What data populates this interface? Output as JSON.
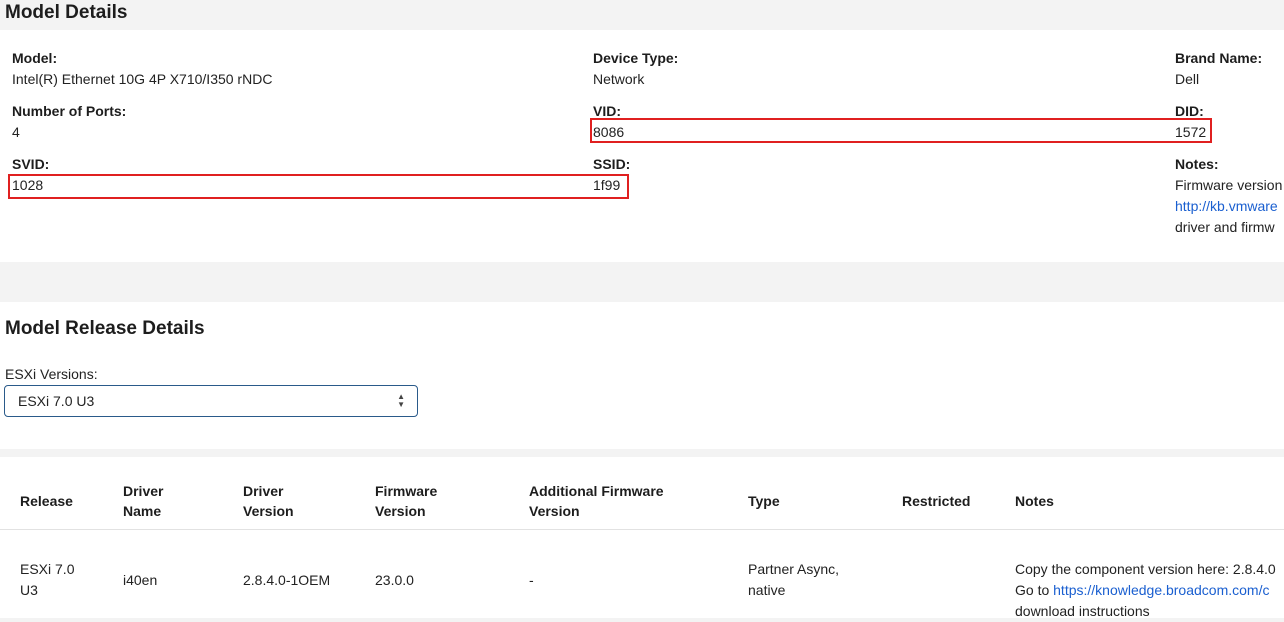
{
  "model_details": {
    "title": "Model Details",
    "model_label": "Model:",
    "model_value": "Intel(R) Ethernet 10G 4P X710/I350 rNDC",
    "device_type_label": "Device Type:",
    "device_type_value": "Network",
    "brand_label": "Brand Name:",
    "brand_value": "Dell",
    "ports_label": "Number of Ports:",
    "ports_value": "4",
    "vid_label": "VID:",
    "vid_value": "8086",
    "did_label": "DID:",
    "did_value": "1572",
    "svid_label": "SVID:",
    "svid_value": "1028",
    "ssid_label": "SSID:",
    "ssid_value": "1f99",
    "notes_label": "Notes:",
    "notes_line1": "Firmware version",
    "notes_link": "http://kb.vmware",
    "notes_line3": "driver and firmw"
  },
  "release_details": {
    "title": "Model Release Details",
    "esxi_label": "ESXi Versions:",
    "esxi_selected": "ESXi 7.0 U3"
  },
  "table": {
    "headers": {
      "release": "Release",
      "driver_name_1": "Driver",
      "driver_name_2": "Name",
      "driver_version_1": "Driver",
      "driver_version_2": "Version",
      "firmware_1": "Firmware",
      "firmware_2": "Version",
      "addl_fw_1": "Additional Firmware",
      "addl_fw_2": "Version",
      "type": "Type",
      "restricted": "Restricted",
      "notes": "Notes"
    },
    "row": {
      "release_1": "ESXi 7.0",
      "release_2": "U3",
      "driver_name": "i40en",
      "driver_version": "2.8.4.0-1OEM",
      "firmware": "23.0.0",
      "addl_fw": "-",
      "type_1": "Partner Async,",
      "type_2": "native",
      "restricted": "",
      "notes_1": "Copy the component version here: 2.8.4.0",
      "notes_2_prefix": "Go to ",
      "notes_2_link": "https://knowledge.broadcom.com/c",
      "notes_3": "download instructions"
    }
  },
  "colors": {
    "highlight": "#e02020",
    "link": "#1a5fd0"
  }
}
